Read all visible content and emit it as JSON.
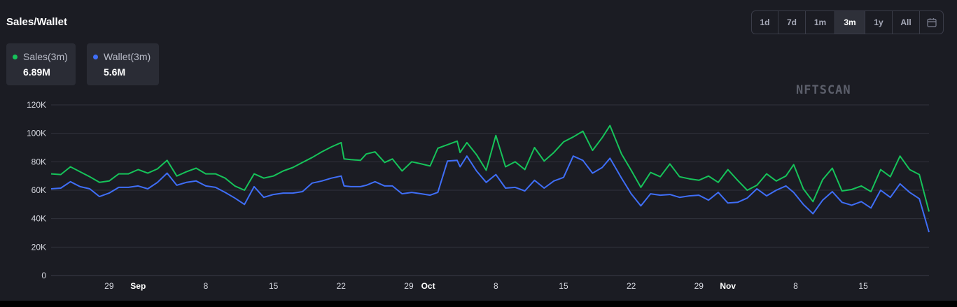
{
  "title": "Sales/Wallet",
  "watermark": "NFTSCAN",
  "range_buttons": [
    "1d",
    "7d",
    "1m",
    "3m",
    "1y",
    "All"
  ],
  "active_range": "3m",
  "calendar_icon": "calendar-icon",
  "stats": [
    {
      "label": "Sales(3m)",
      "value": "6.89M",
      "color": "#16c35a"
    },
    {
      "label": "Wallet(3m)",
      "value": "5.6M",
      "color": "#3f6ef7"
    }
  ],
  "chart_data": {
    "type": "line",
    "title": "",
    "xlabel": "",
    "ylabel": "",
    "ylim": [
      0,
      120000
    ],
    "y_ticks": [
      "0",
      "20K",
      "40K",
      "60K",
      "80K",
      "100K",
      "120K"
    ],
    "x_ticks": [
      {
        "label": "29",
        "day": 6,
        "bold": false
      },
      {
        "label": "Sep",
        "day": 9,
        "bold": true
      },
      {
        "label": "8",
        "day": 16,
        "bold": false
      },
      {
        "label": "15",
        "day": 23,
        "bold": false
      },
      {
        "label": "22",
        "day": 30,
        "bold": false
      },
      {
        "label": "29",
        "day": 37,
        "bold": false
      },
      {
        "label": "Oct",
        "day": 39,
        "bold": true
      },
      {
        "label": "8",
        "day": 46,
        "bold": false
      },
      {
        "label": "15",
        "day": 53,
        "bold": false
      },
      {
        "label": "22",
        "day": 60,
        "bold": false
      },
      {
        "label": "29",
        "day": 67,
        "bold": false
      },
      {
        "label": "Nov",
        "day": 70,
        "bold": true
      },
      {
        "label": "8",
        "day": 77,
        "bold": false
      },
      {
        "label": "15",
        "day": 84,
        "bold": false
      }
    ],
    "grid": true,
    "series": [
      {
        "name": "Sales(3m)",
        "color": "#16c35a",
        "values": [
          [
            0,
            71500
          ],
          [
            1,
            71000
          ],
          [
            2,
            76500
          ],
          [
            3,
            73000
          ],
          [
            4,
            69500
          ],
          [
            5,
            65500
          ],
          [
            6,
            66500
          ],
          [
            7,
            71500
          ],
          [
            8,
            71500
          ],
          [
            9,
            74500
          ],
          [
            10,
            72000
          ],
          [
            11,
            75000
          ],
          [
            12,
            81000
          ],
          [
            13,
            70000
          ],
          [
            14,
            73000
          ],
          [
            15,
            75500
          ],
          [
            16,
            71500
          ],
          [
            17,
            71500
          ],
          [
            18,
            68500
          ],
          [
            19,
            63000
          ],
          [
            20,
            60000
          ],
          [
            21,
            71500
          ],
          [
            22,
            68500
          ],
          [
            23,
            70000
          ],
          [
            24,
            73500
          ],
          [
            25,
            76000
          ],
          [
            26,
            79500
          ],
          [
            27,
            83000
          ],
          [
            28,
            87000
          ],
          [
            29,
            90500
          ],
          [
            30,
            93500
          ],
          [
            30.3,
            82000
          ],
          [
            31,
            81500
          ],
          [
            32,
            81000
          ],
          [
            32.6,
            85500
          ],
          [
            33.5,
            87000
          ],
          [
            34.5,
            79500
          ],
          [
            35.3,
            82000
          ],
          [
            36.3,
            73500
          ],
          [
            37.3,
            80000
          ],
          [
            38.3,
            78500
          ],
          [
            39.2,
            77000
          ],
          [
            40,
            89500
          ],
          [
            41,
            92000
          ],
          [
            42,
            94500
          ],
          [
            42.3,
            86500
          ],
          [
            43,
            93500
          ],
          [
            44,
            85000
          ],
          [
            45,
            74000
          ],
          [
            46,
            98500
          ],
          [
            47,
            76500
          ],
          [
            48,
            80000
          ],
          [
            49,
            74500
          ],
          [
            50,
            90000
          ],
          [
            51,
            80500
          ],
          [
            52,
            86500
          ],
          [
            53,
            94000
          ],
          [
            54,
            97500
          ],
          [
            55,
            101500
          ],
          [
            56,
            88000
          ],
          [
            57,
            97000
          ],
          [
            57.8,
            105500
          ],
          [
            59,
            85500
          ],
          [
            60,
            74000
          ],
          [
            61,
            62000
          ],
          [
            62,
            72500
          ],
          [
            63,
            69500
          ],
          [
            64,
            78500
          ],
          [
            65,
            69500
          ],
          [
            66,
            68000
          ],
          [
            67,
            67000
          ],
          [
            68,
            70000
          ],
          [
            69,
            65500
          ],
          [
            70,
            74500
          ],
          [
            71,
            67000
          ],
          [
            72,
            60000
          ],
          [
            73,
            63500
          ],
          [
            74,
            71500
          ],
          [
            75,
            66500
          ],
          [
            76,
            70000
          ],
          [
            76.8,
            78000
          ],
          [
            77.8,
            61000
          ],
          [
            78.8,
            52000
          ],
          [
            79.8,
            67500
          ],
          [
            80.8,
            75500
          ],
          [
            81.8,
            59500
          ],
          [
            82.8,
            60500
          ],
          [
            83.8,
            63000
          ],
          [
            84.8,
            59000
          ],
          [
            85.8,
            74500
          ],
          [
            86.8,
            69500
          ],
          [
            87.8,
            84000
          ],
          [
            88.8,
            74500
          ],
          [
            89.8,
            71000
          ],
          [
            90.8,
            45000
          ]
        ]
      },
      {
        "name": "Wallet(3m)",
        "color": "#3f6ef7",
        "values": [
          [
            0,
            61000
          ],
          [
            1,
            61500
          ],
          [
            2,
            66000
          ],
          [
            3,
            62500
          ],
          [
            4,
            61000
          ],
          [
            5,
            55500
          ],
          [
            6,
            58000
          ],
          [
            7,
            62000
          ],
          [
            8,
            62000
          ],
          [
            9,
            63000
          ],
          [
            10,
            61000
          ],
          [
            11,
            65500
          ],
          [
            12,
            72000
          ],
          [
            13,
            63500
          ],
          [
            14,
            65500
          ],
          [
            15,
            66500
          ],
          [
            16,
            63000
          ],
          [
            17,
            62000
          ],
          [
            18,
            58500
          ],
          [
            19,
            54500
          ],
          [
            20,
            50000
          ],
          [
            21,
            62500
          ],
          [
            22,
            55000
          ],
          [
            23,
            57000
          ],
          [
            24,
            58000
          ],
          [
            25,
            58000
          ],
          [
            26,
            59000
          ],
          [
            27,
            65000
          ],
          [
            28,
            66500
          ],
          [
            29,
            68500
          ],
          [
            30,
            70000
          ],
          [
            30.3,
            63000
          ],
          [
            31,
            62500
          ],
          [
            32,
            62500
          ],
          [
            32.6,
            63500
          ],
          [
            33.5,
            66000
          ],
          [
            34.5,
            63000
          ],
          [
            35.3,
            63000
          ],
          [
            36.3,
            57500
          ],
          [
            37.3,
            58500
          ],
          [
            38.3,
            57500
          ],
          [
            39.2,
            56500
          ],
          [
            40,
            58500
          ],
          [
            41,
            80500
          ],
          [
            42,
            81000
          ],
          [
            42.3,
            76500
          ],
          [
            43,
            84000
          ],
          [
            44,
            73500
          ],
          [
            45,
            65500
          ],
          [
            46,
            71000
          ],
          [
            47,
            61500
          ],
          [
            48,
            62000
          ],
          [
            49,
            59500
          ],
          [
            50,
            67000
          ],
          [
            51,
            61500
          ],
          [
            52,
            66500
          ],
          [
            53,
            69000
          ],
          [
            54,
            84000
          ],
          [
            55,
            81000
          ],
          [
            56,
            72000
          ],
          [
            57,
            76000
          ],
          [
            57.8,
            82500
          ],
          [
            59,
            68500
          ],
          [
            60,
            57500
          ],
          [
            61,
            49000
          ],
          [
            62,
            57500
          ],
          [
            63,
            56500
          ],
          [
            64,
            57000
          ],
          [
            65,
            55000
          ],
          [
            66,
            56000
          ],
          [
            67,
            56500
          ],
          [
            68,
            53000
          ],
          [
            69,
            58500
          ],
          [
            70,
            51000
          ],
          [
            71,
            51500
          ],
          [
            72,
            54500
          ],
          [
            73,
            61000
          ],
          [
            74,
            56000
          ],
          [
            75,
            60000
          ],
          [
            76,
            63000
          ],
          [
            76.8,
            58500
          ],
          [
            77.8,
            50000
          ],
          [
            78.8,
            43500
          ],
          [
            79.8,
            53000
          ],
          [
            80.8,
            59000
          ],
          [
            81.8,
            51500
          ],
          [
            82.8,
            49500
          ],
          [
            83.8,
            52000
          ],
          [
            84.8,
            47500
          ],
          [
            85.8,
            60000
          ],
          [
            86.8,
            55000
          ],
          [
            87.8,
            64500
          ],
          [
            88.8,
            58500
          ],
          [
            89.8,
            54000
          ],
          [
            90.8,
            30500
          ]
        ]
      }
    ]
  }
}
